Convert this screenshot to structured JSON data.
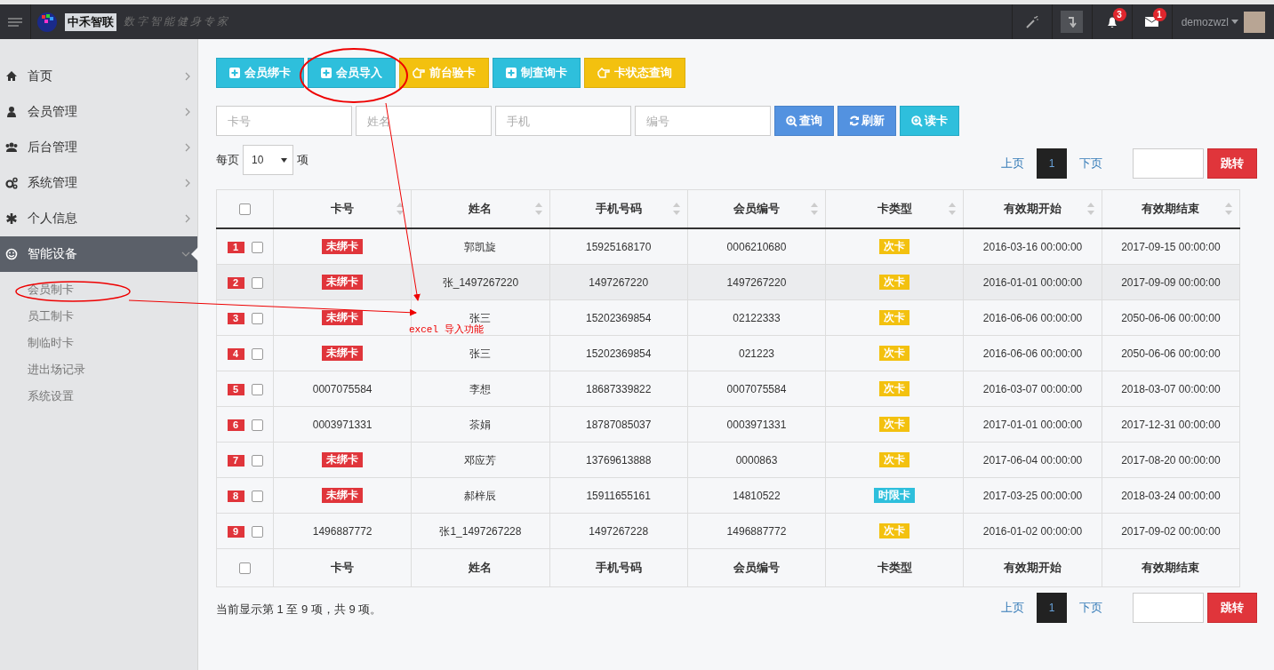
{
  "topbar": {
    "logo": "中禾智联",
    "slogan": "数字智能健身专家",
    "notifications": "3",
    "messages": "1",
    "user": "demozwzl"
  },
  "sidebar": {
    "items": [
      {
        "label": "首页",
        "expanded": false,
        "selected": false
      },
      {
        "label": "会员管理",
        "expanded": false,
        "selected": false
      },
      {
        "label": "后台管理",
        "expanded": false,
        "selected": false
      },
      {
        "label": "系统管理",
        "expanded": false,
        "selected": false
      },
      {
        "label": "个人信息",
        "expanded": false,
        "selected": false
      },
      {
        "label": "智能设备",
        "expanded": true,
        "selected": true,
        "children": [
          {
            "label": "会员制卡"
          },
          {
            "label": "员工制卡"
          },
          {
            "label": "制临时卡"
          },
          {
            "label": "进出场记录"
          },
          {
            "label": "系统设置"
          }
        ]
      }
    ]
  },
  "toolbar": [
    {
      "label": "会员绑卡",
      "kind": "plus"
    },
    {
      "label": "会员导入",
      "kind": "plus"
    },
    {
      "label": "前台验卡",
      "kind": "hand"
    },
    {
      "label": "制查询卡",
      "kind": "plus"
    },
    {
      "label": "卡状态查询",
      "kind": "hand"
    }
  ],
  "search": {
    "fields": [
      {
        "placeholder": "卡号"
      },
      {
        "placeholder": "姓名"
      },
      {
        "placeholder": "手机"
      },
      {
        "placeholder": "编号"
      }
    ],
    "buttons": [
      {
        "label": "查询",
        "kind": "search"
      },
      {
        "label": "刷新",
        "kind": "refresh"
      },
      {
        "label": "读卡",
        "kind": "read"
      }
    ]
  },
  "page_size": {
    "before": "每页",
    "value": "10",
    "after": "项"
  },
  "pagination_top": {
    "prev": "上页",
    "pages": [
      {
        "label": "1",
        "selected": true
      }
    ],
    "next": "下页",
    "jump": "跳转"
  },
  "table": {
    "header_checked": false,
    "columns": [
      "卡号",
      "姓名",
      "手机号码",
      "会员编号",
      "卡类型",
      "有效期开始",
      "有效期结束"
    ],
    "rows": [
      {
        "index": "1",
        "checked": false,
        "card": {
          "text": "未绑卡",
          "kind": "badge"
        },
        "name": "郭凯旋",
        "phone": "15925168170",
        "member_no": "0006210680",
        "card_type": {
          "text": "次卡",
          "kind": "count"
        },
        "start": "2016-03-16 00:00:00",
        "end": "2017-09-15 00:00:00"
      },
      {
        "index": "2",
        "checked": false,
        "card": {
          "text": "未绑卡",
          "kind": "badge"
        },
        "name": "张_1497267220",
        "phone": "1497267220",
        "member_no": "1497267220",
        "card_type": {
          "text": "次卡",
          "kind": "count"
        },
        "start": "2016-01-01 00:00:00",
        "end": "2017-09-09 00:00:00"
      },
      {
        "index": "3",
        "checked": false,
        "card": {
          "text": "未绑卡",
          "kind": "badge"
        },
        "name": "张三",
        "phone": "15202369854",
        "member_no": "02122333",
        "card_type": {
          "text": "次卡",
          "kind": "count"
        },
        "start": "2016-06-06 00:00:00",
        "end": "2050-06-06 00:00:00"
      },
      {
        "index": "4",
        "checked": false,
        "card": {
          "text": "未绑卡",
          "kind": "badge"
        },
        "name": "张三",
        "phone": "15202369854",
        "member_no": "021223",
        "card_type": {
          "text": "次卡",
          "kind": "count"
        },
        "start": "2016-06-06 00:00:00",
        "end": "2050-06-06 00:00:00"
      },
      {
        "index": "5",
        "checked": false,
        "card": {
          "text": "0007075584",
          "kind": "plain"
        },
        "name": "李想",
        "phone": "18687339822",
        "member_no": "0007075584",
        "card_type": {
          "text": "次卡",
          "kind": "count"
        },
        "start": "2016-03-07 00:00:00",
        "end": "2018-03-07 00:00:00"
      },
      {
        "index": "6",
        "checked": false,
        "card": {
          "text": "0003971331",
          "kind": "plain"
        },
        "name": "茶娟",
        "phone": "18787085037",
        "member_no": "0003971331",
        "card_type": {
          "text": "次卡",
          "kind": "count"
        },
        "start": "2017-01-01 00:00:00",
        "end": "2017-12-31 00:00:00"
      },
      {
        "index": "7",
        "checked": false,
        "card": {
          "text": "未绑卡",
          "kind": "badge"
        },
        "name": "邓应芳",
        "phone": "13769613888",
        "member_no": "0000863",
        "card_type": {
          "text": "次卡",
          "kind": "count"
        },
        "start": "2017-06-04 00:00:00",
        "end": "2017-08-20 00:00:00"
      },
      {
        "index": "8",
        "checked": false,
        "card": {
          "text": "未绑卡",
          "kind": "badge"
        },
        "name": "郝梓辰",
        "phone": "15911655161",
        "member_no": "14810522",
        "card_type": {
          "text": "时限卡",
          "kind": "time"
        },
        "start": "2017-03-25 00:00:00",
        "end": "2018-03-24 00:00:00"
      },
      {
        "index": "9",
        "checked": false,
        "card": {
          "text": "1496887772",
          "kind": "plain"
        },
        "name": "张1_1497267228",
        "phone": "1497267228",
        "member_no": "1496887772",
        "card_type": {
          "text": "次卡",
          "kind": "count"
        },
        "start": "2016-01-02 00:00:00",
        "end": "2017-09-02 00:00:00"
      }
    ],
    "footer_checked": false,
    "footer_columns": [
      "卡号",
      "姓名",
      "手机号码",
      "会员编号",
      "卡类型",
      "有效期开始",
      "有效期结束"
    ]
  },
  "info": "当前显示第 1 至 9 项，共 9 项。",
  "pagination_bottom": {
    "prev": "上页",
    "pages": [
      {
        "label": "1",
        "selected": true
      }
    ],
    "next": "下页",
    "jump": "跳转"
  },
  "annotation": {
    "note": "excel 导入功能"
  }
}
